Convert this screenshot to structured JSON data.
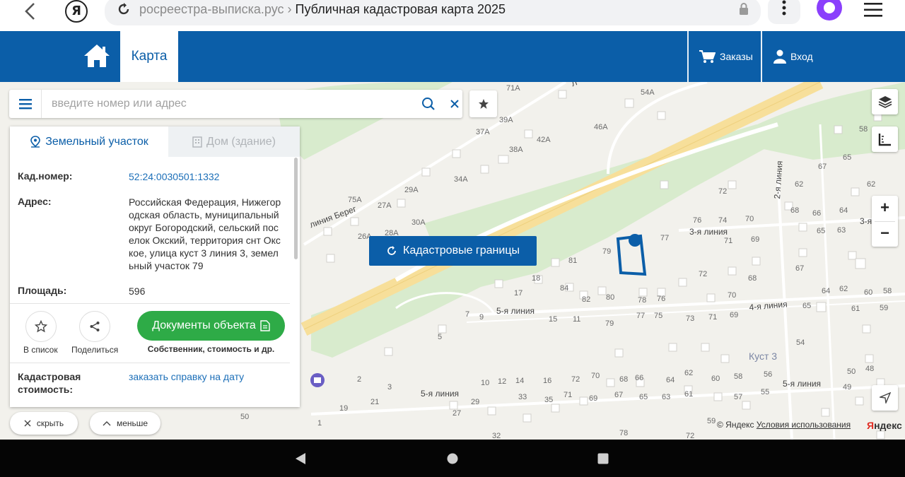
{
  "browser": {
    "url_host": "росреестра-выписка.рус",
    "separator": "›",
    "page_title": "Публичная кадастровая карта 2025"
  },
  "header": {
    "tab_map": "Карта",
    "orders": "Заказы",
    "login": "Вход",
    "brand_color": "#0b5ea8"
  },
  "search": {
    "placeholder": "введите номер или адрес"
  },
  "panel": {
    "tab_land": "Земельный участок",
    "tab_house": "Дом (здание)",
    "cad_number_label": "Кад.номер:",
    "cad_number_value": "52:24:0030501:1332",
    "address_label": "Адрес:",
    "address_value": "Российская Федерация, Нижегородская область, муниципальный округ Богородский, сельский поселок Окский, территория снт Окское, улица куст 3 линия 3, земельный участок 79",
    "area_label": "Площадь:",
    "area_value": "596",
    "add_to_list": "В список",
    "share": "Поделиться",
    "docs_button": "Документы объекта",
    "docs_caption": "Собственник, стоимость и др.",
    "cad_cost_label": "Кадастровая стоимость:",
    "cad_cost_link": "заказать справку на дату"
  },
  "pills": {
    "hide": "скрыть",
    "less": "меньше"
  },
  "map": {
    "cadastral_button": "Кадастровые границы",
    "copyright": "© Яндекс",
    "terms": "Условия использования",
    "logo_letter": "Я",
    "logo_rest": "ндекс",
    "labels": {
      "l71a": "71А",
      "l54a": "54А",
      "l39a": "39А",
      "l46a": "46А",
      "l37a": "37А",
      "l42a": "42А",
      "l38a": "38А",
      "l34a": "34А",
      "l29a": "29А",
      "l75a": "75А",
      "l27a": "27А",
      "l30a": "30А",
      "l26a": "26А",
      "l28a": "28А",
      "l58": "58",
      "l65": "65",
      "l67": "67",
      "l62": "62",
      "l72": "72",
      "l76": "76",
      "l74": "74",
      "l70": "70",
      "l68": "68",
      "l66": "66",
      "l64": "64",
      "l65b": "65",
      "l63": "63",
      "l77": "77",
      "l71": "71",
      "l69": "69",
      "l79": "79",
      "l81": "81",
      "l18": "18",
      "l84": "84",
      "l17": "17",
      "l82": "82",
      "l80": "80",
      "l78": "78",
      "l76b": "76",
      "l72b": "72",
      "l68b": "68",
      "l67b": "67",
      "l64b": "64",
      "l62b": "62",
      "l60": "60",
      "l58b": "58",
      "l70b": "70",
      "l7": "7",
      "l9": "9",
      "l15": "15",
      "l11": "11",
      "l79b": "79",
      "l77b": "77",
      "l75": "75",
      "l73": "73",
      "l71b": "71",
      "l69b": "69",
      "l65c": "65",
      "l61": "61",
      "l59": "59",
      "l5": "5",
      "l54": "54",
      "l50": "50",
      "l48": "48",
      "l49": "49",
      "l2": "2",
      "l3": "3",
      "l10": "10",
      "l12": "12",
      "l14": "14",
      "l16": "16",
      "l72c": "72",
      "l70c": "70",
      "l68c": "68",
      "l66b": "66",
      "l64c": "64",
      "l62c": "62",
      "l60b": "60",
      "l58c": "58",
      "l56": "56",
      "l55": "55",
      "l21": "21",
      "l19": "19",
      "l27": "27",
      "l29": "29",
      "l33": "33",
      "l35": "35",
      "l71c": "71",
      "l69c": "69",
      "l67c": "67",
      "l65d": "65",
      "l63b": "63",
      "l61b": "61",
      "l57": "57",
      "l50b": "50",
      "l1": "1",
      "l78b": "78",
      "l32": "32",
      "l59b": "59",
      "l72d": "72"
    },
    "streets": {
      "line_bereg": "линия Берег",
      "line3": "3-я линия",
      "line3b": "3-я",
      "line2": "2-я линия",
      "line4": "4-я линия",
      "line5a": "5-я линия",
      "line5b": "5-я линия",
      "line5c": "5-я линия",
      "kust3": "Куст 3",
      "l_partial": "Л"
    }
  }
}
